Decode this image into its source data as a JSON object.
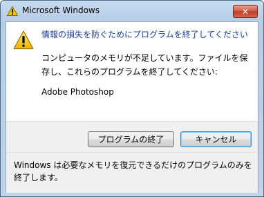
{
  "window": {
    "title": "Microsoft Windows",
    "close_label": "✕"
  },
  "dialog": {
    "instruction": "情報の損失を防ぐためにプログラムを終了してください",
    "message": "コンピュータのメモリが不足しています。ファイルを保存し、これらのプログラムを終了してください:",
    "program": "Adobe Photoshop"
  },
  "buttons": {
    "end_program": "プログラムの終了",
    "cancel": "キャンセル"
  },
  "footer": {
    "text": "Windows は必要なメモリを復元できるだけのプログラムのみを終了します。"
  },
  "icons": {
    "title_icon": "warning-icon",
    "main_icon": "warning-icon",
    "close_icon": "close-icon"
  },
  "colors": {
    "instruction": "#1a3e9a",
    "warning_fill": "#f4c20d",
    "close_button": "#c0391f"
  }
}
